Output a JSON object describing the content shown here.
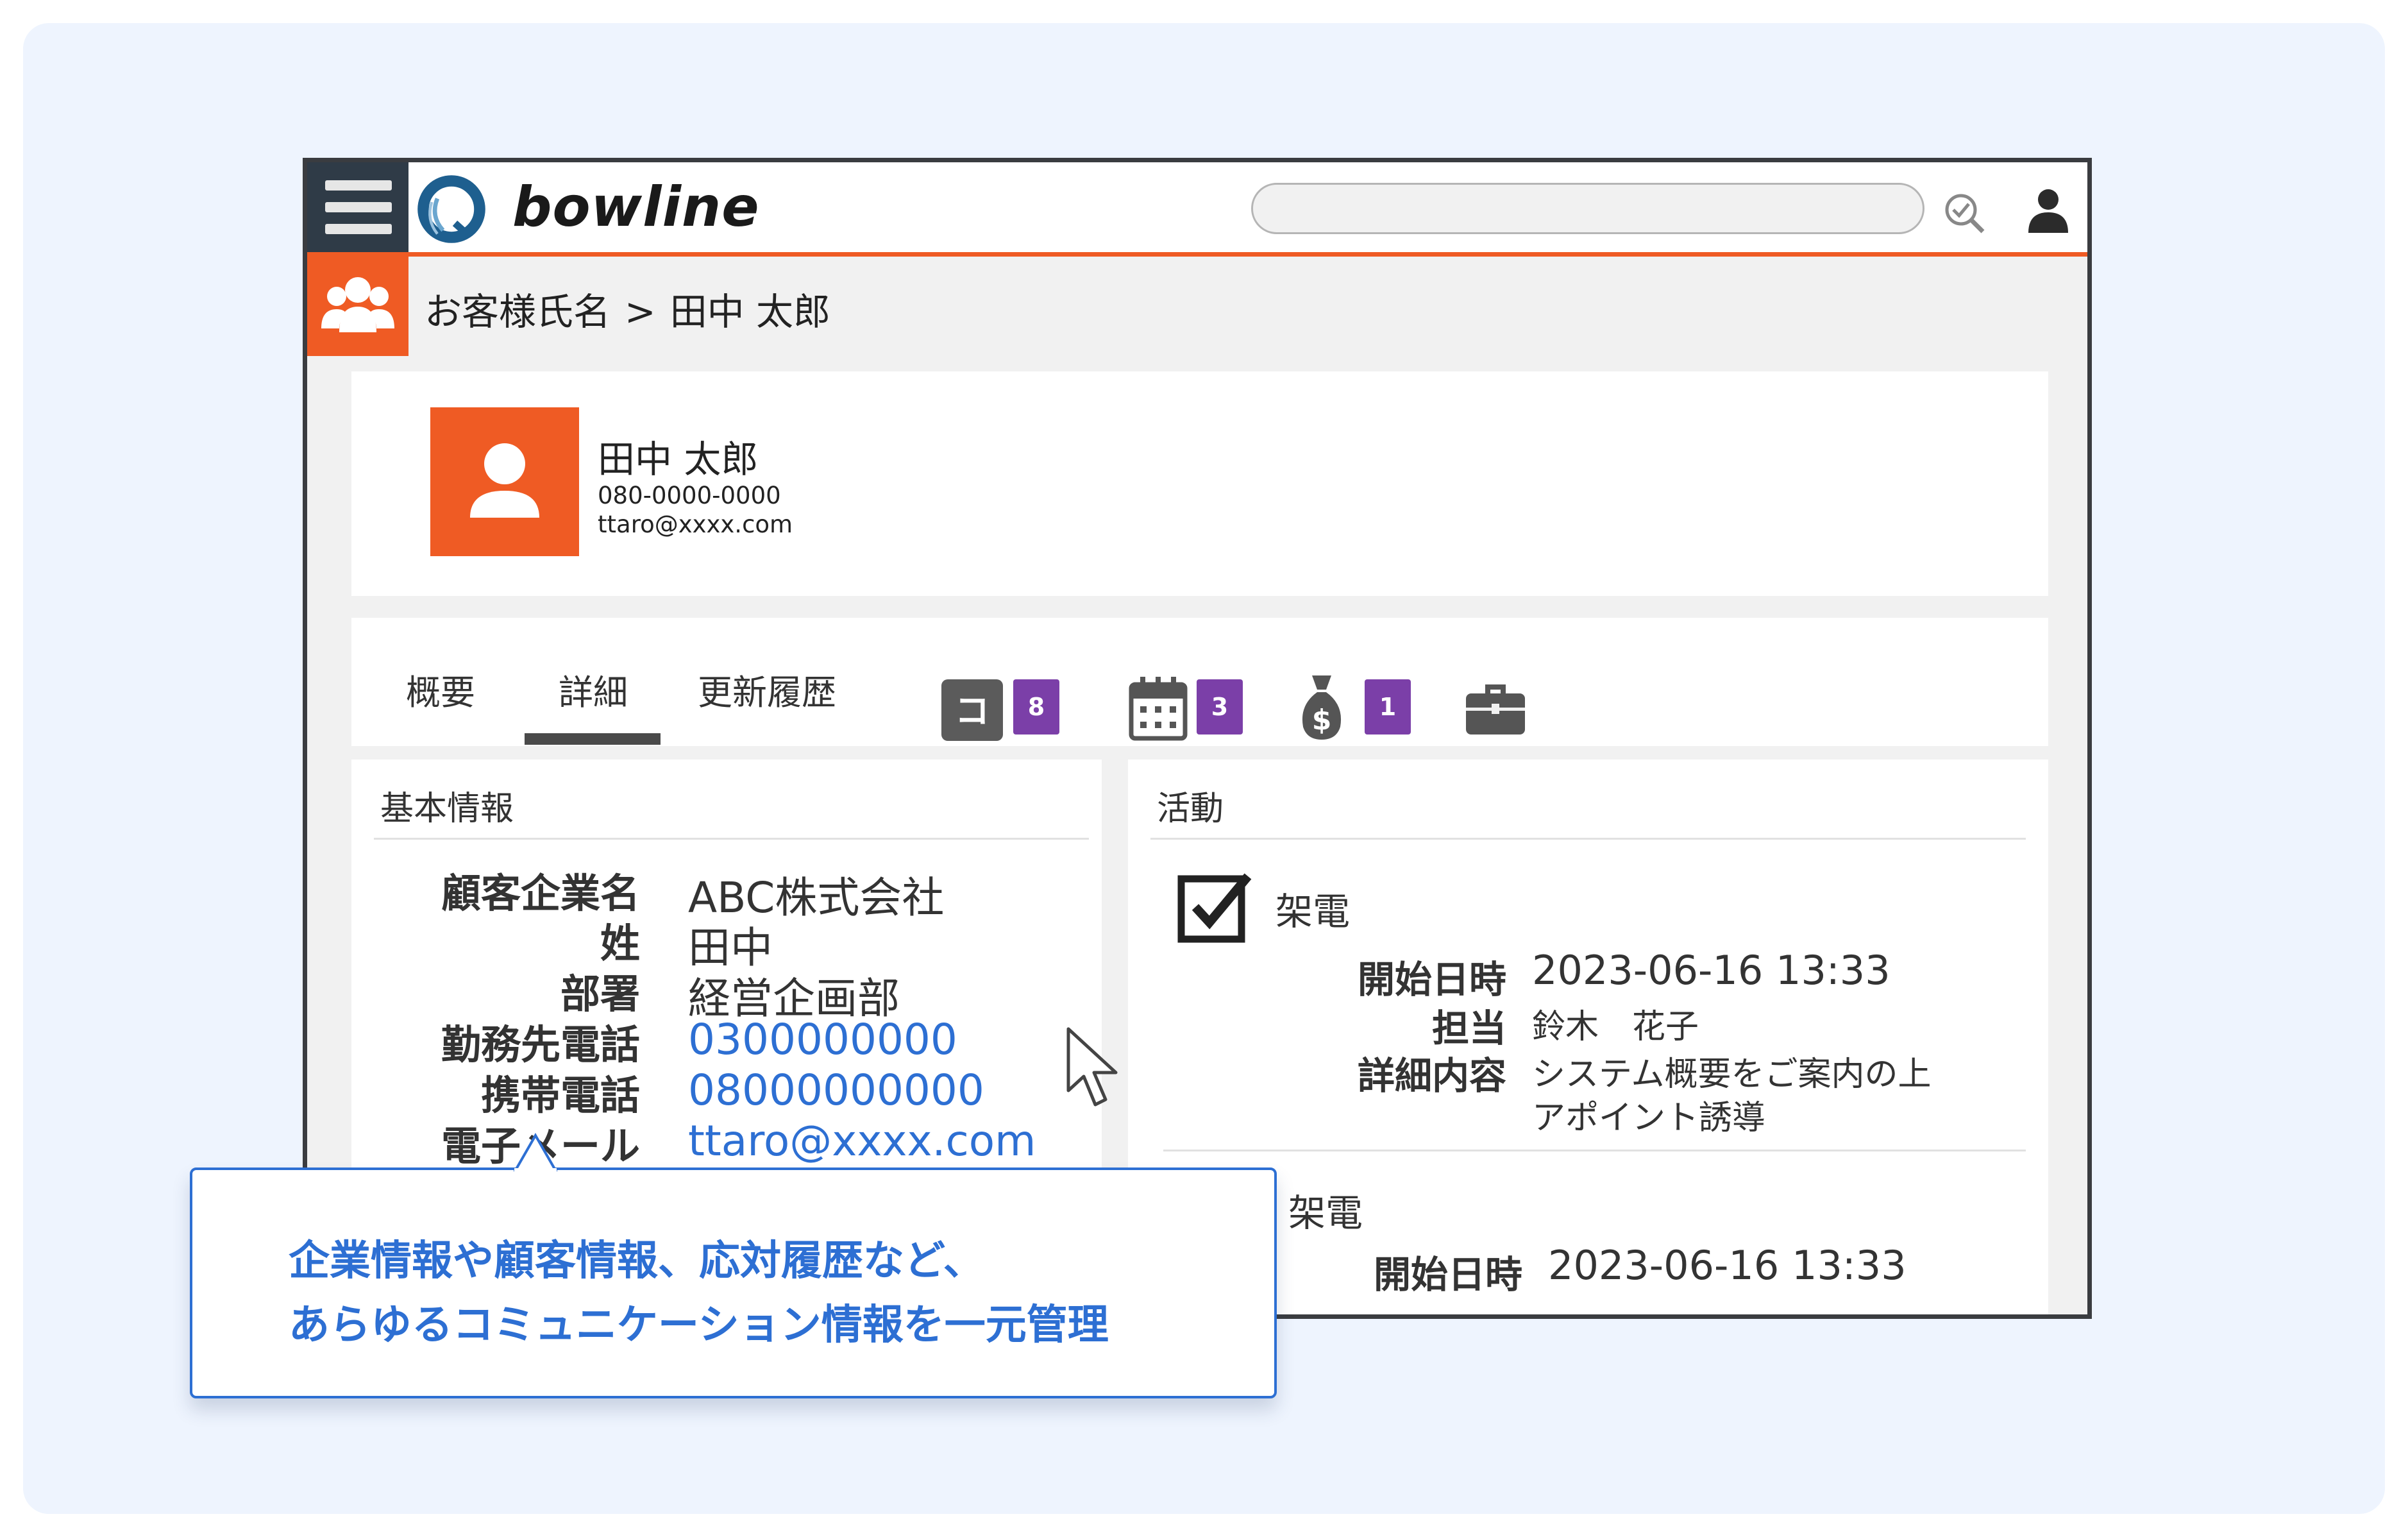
{
  "app": {
    "logo_text": "bowline"
  },
  "search": {
    "placeholder": "",
    "value": ""
  },
  "breadcrumb": {
    "parent": "お客様氏名",
    "separator": ">",
    "current": "田中 太郎"
  },
  "profile": {
    "name": "田中 太郎",
    "phone": "080-0000-0000",
    "email": "ttaro@xxxx.com"
  },
  "tabs": {
    "items": [
      {
        "label": "概要"
      },
      {
        "label": "詳細"
      },
      {
        "label": "更新履歴"
      }
    ],
    "active": "詳細",
    "icon_badges": [
      {
        "icon": "comment-icon",
        "glyph": "コ",
        "count": "8"
      },
      {
        "icon": "calendar-icon",
        "count": "3"
      },
      {
        "icon": "money-bag-icon",
        "count": "1"
      },
      {
        "icon": "briefcase-icon"
      }
    ]
  },
  "basic_info": {
    "title": "基本情報",
    "fields": [
      {
        "label": "顧客企業名",
        "value": "ABC株式会社"
      },
      {
        "label": "姓",
        "value": "田中"
      },
      {
        "label": "部署",
        "value": "経営企画部"
      },
      {
        "label": "勤務先電話",
        "value": "0300000000"
      },
      {
        "label": "携帯電話",
        "value": "08000000000"
      },
      {
        "label": "電子メール",
        "value": "ttaro@xxxx.com"
      }
    ]
  },
  "activity": {
    "title": "活動",
    "items": [
      {
        "type": "架電",
        "fields": [
          {
            "label": "開始日時",
            "value": "2023-06-16 13:33"
          },
          {
            "label": "担当",
            "value": "鈴木　花子"
          },
          {
            "label": "詳細内容",
            "value_line1": "システム概要をご案内の上",
            "value_line2": "アポイント誘導"
          }
        ]
      },
      {
        "type": "架電",
        "fields": [
          {
            "label": "開始日時",
            "value": "2023-06-16 13:33"
          }
        ]
      }
    ]
  },
  "callout": {
    "line1": "企業情報や顧客情報、応対履歴など、",
    "line2": "あらゆるコミュニケーション情報を一元管理"
  },
  "colors": {
    "accent": "#ef5b24",
    "link": "#2d6fd3",
    "badge": "#7b3fa8",
    "header_dark": "#2f3b47",
    "panel_bg": "#eef4fe"
  }
}
